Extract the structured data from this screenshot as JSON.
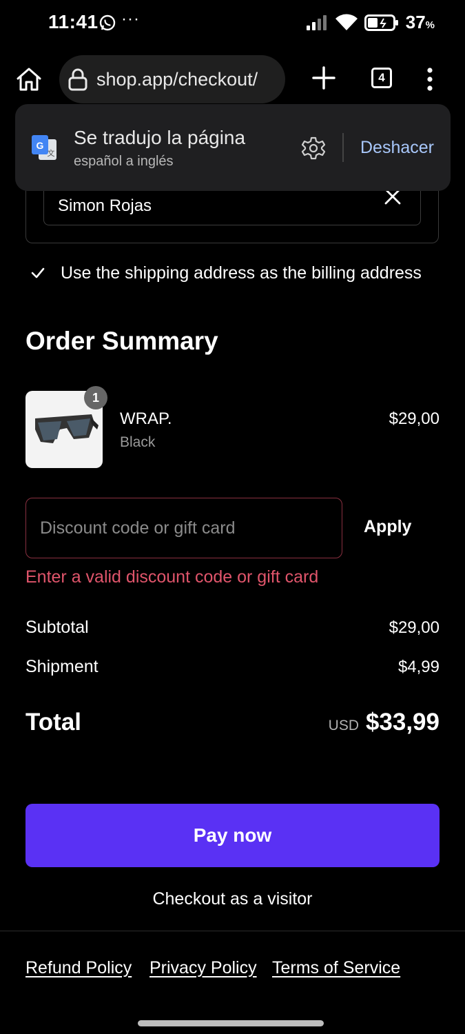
{
  "status_bar": {
    "time": "11:41",
    "more": "···",
    "battery_percent": "37",
    "battery_unit": "%"
  },
  "browser": {
    "url": "shop.app/checkout/",
    "tab_count": "4"
  },
  "translate_popup": {
    "title": "Se tradujo la página",
    "subtitle": "español a inglés",
    "undo_label": "Deshacer"
  },
  "shipping": {
    "name_value": "Simon Rojas",
    "billing_same_label": "Use the shipping address as the billing address",
    "billing_same_checked": true
  },
  "order_summary": {
    "title": "Order Summary",
    "item": {
      "quantity": "1",
      "name": "WRAP.",
      "variant": "Black",
      "price": "$29,00"
    }
  },
  "discount": {
    "placeholder": "Discount code or gift card",
    "apply_label": "Apply",
    "error": "Enter a valid discount code or gift card"
  },
  "totals": {
    "subtotal_label": "Subtotal",
    "subtotal_value": "$29,00",
    "shipment_label": "Shipment",
    "shipment_value": "$4,99",
    "total_label": "Total",
    "currency": "USD",
    "total_value": "$33,99"
  },
  "actions": {
    "pay_label": "Pay now",
    "visitor_label": "Checkout as a visitor"
  },
  "footer": {
    "refund": "Refund Policy",
    "privacy": "Privacy Policy",
    "terms": "Terms of Service"
  },
  "colors": {
    "background": "#000000",
    "pay_button": "#5a31f4",
    "error": "#e0556b",
    "translate_accent": "#a8c7fa"
  }
}
